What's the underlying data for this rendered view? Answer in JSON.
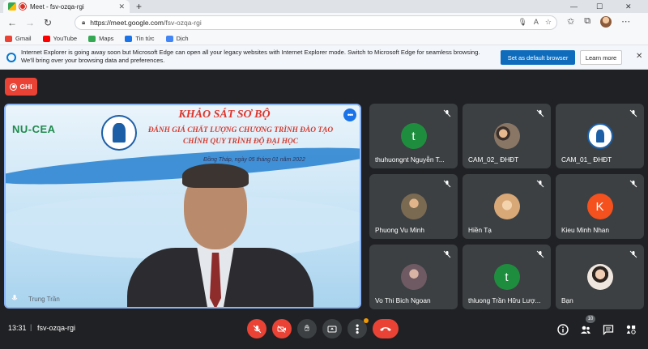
{
  "browser": {
    "tab_title": "Meet - fsv-ozqa-rgi",
    "tab_close": "✕",
    "new_tab": "+",
    "url_host": "https://meet.google.com",
    "url_path": "/fsv-ozqa-rgi",
    "win_min": "—",
    "win_max": "☐",
    "win_close": "✕"
  },
  "bookmarks": [
    {
      "label": "Gmail",
      "color": "#ea4335"
    },
    {
      "label": "YouTube",
      "color": "#ff0000"
    },
    {
      "label": "Maps",
      "color": "#34a853"
    },
    {
      "label": "Tin tức",
      "color": "#1a73e8"
    },
    {
      "label": "Dịch",
      "color": "#4285f4"
    }
  ],
  "infobar": {
    "message": "Internet Explorer is going away soon but Microsoft Edge can open all your legacy websites with Internet Explorer mode. Switch to Microsoft Edge for seamless browsing. We'll bring over your browsing data and preferences.",
    "primary_button": "Set as default browser",
    "secondary_button": "Learn more"
  },
  "meet": {
    "record_label": "GHI",
    "main_tile": {
      "slide_title": "KHẢO SÁT SƠ BỘ",
      "slide_line1": "ĐÁNH GIÁ CHẤT LƯỢNG CHƯƠNG TRÌNH ĐÀO TẠO",
      "slide_line2": "CHÍNH QUY TRÌNH ĐỘ ĐẠI HỌC",
      "slide_date": "Đồng Tháp, ngày 05 tháng 01 năm 2022",
      "logo_text": "NU-CEA",
      "speaker_name": "Trung Trần"
    },
    "participants": [
      {
        "name": "thuhuongnt Nguyễn T...",
        "initial": "t",
        "color": "#1e8e3e"
      },
      {
        "name": "CAM_02_ ĐHĐT",
        "initial": "",
        "color": "#6b5b4f"
      },
      {
        "name": "CAM_01_ ĐHĐT",
        "initial": "",
        "color": "#ffffff"
      },
      {
        "name": "Phuong Vu Minh",
        "initial": "",
        "color": "#c9b79c"
      },
      {
        "name": "Hiền Tạ",
        "initial": "",
        "color": "#e9c7a0"
      },
      {
        "name": "Kieu Minh Nhan",
        "initial": "K",
        "color": "#f4511e"
      },
      {
        "name": "Vo Thi Bich Ngoan",
        "initial": "",
        "color": "#7a6670"
      },
      {
        "name": "thluong Trần Hữu Lượ...",
        "initial": "t",
        "color": "#1e8e3e"
      },
      {
        "name": "Bạn",
        "initial": "",
        "color": "#e8d2c0"
      }
    ],
    "bottom": {
      "time": "13:31",
      "separator": "|",
      "meeting_code": "fsv-ozqa-rgi",
      "participant_count": "10"
    },
    "colors": {
      "background": "#202124",
      "tile": "#3c4043",
      "danger": "#ea4335",
      "accent": "#8ab4f8"
    }
  }
}
